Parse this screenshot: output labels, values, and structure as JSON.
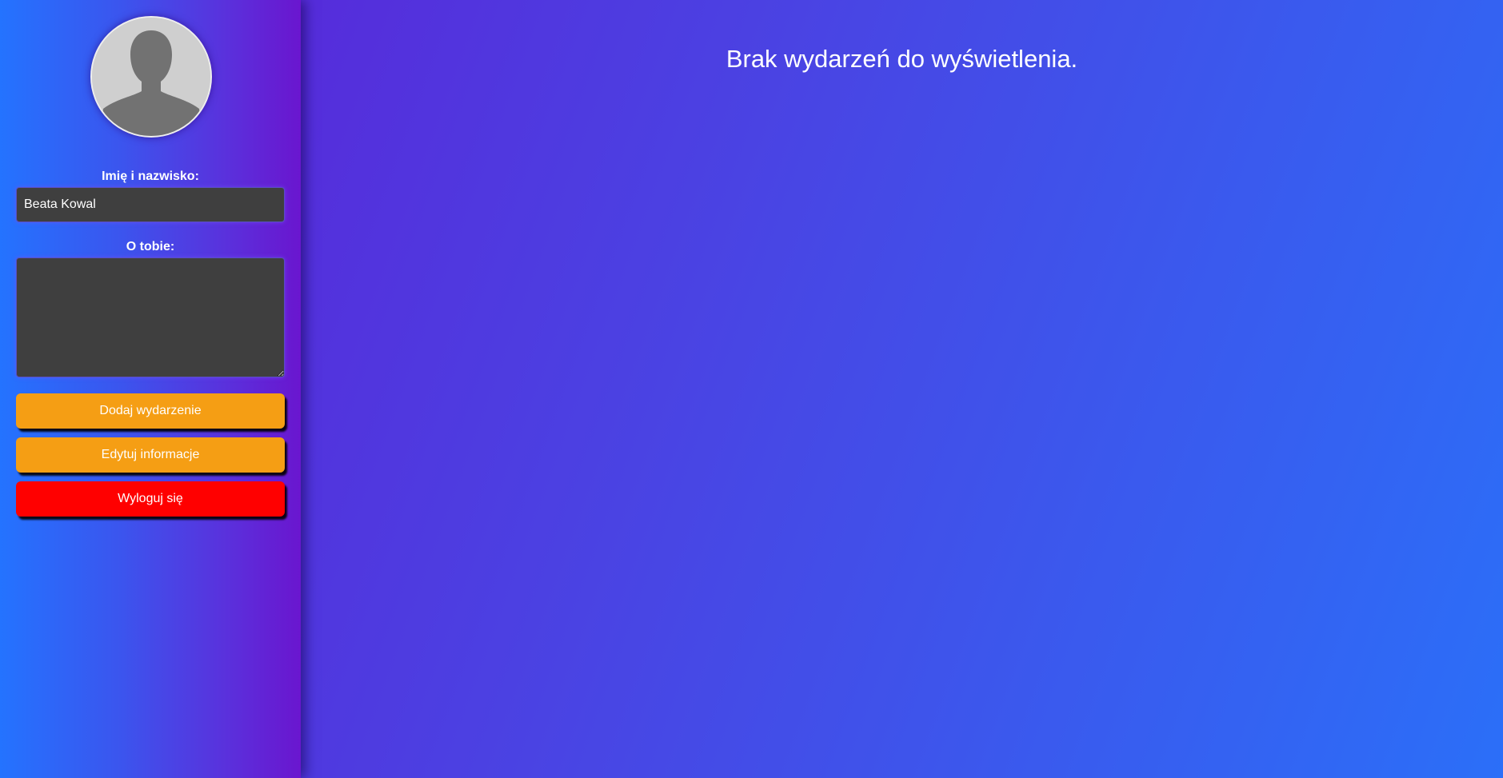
{
  "sidebar": {
    "avatar_icon": "default-user-silhouette-icon",
    "name_label": "Imię i nazwisko:",
    "name_value": "Beata Kowal",
    "about_label": "O tobie:",
    "about_value": "",
    "buttons": {
      "add_event": "Dodaj wydarzenie",
      "edit_info": "Edytuj informacje",
      "logout": "Wyloguj się"
    }
  },
  "main": {
    "empty_message": "Brak wydarzeń do wyświetlenia."
  },
  "colors": {
    "accent_orange": "#f59e14",
    "logout_red": "#ff0000",
    "input_bg": "#3f3f3f"
  }
}
